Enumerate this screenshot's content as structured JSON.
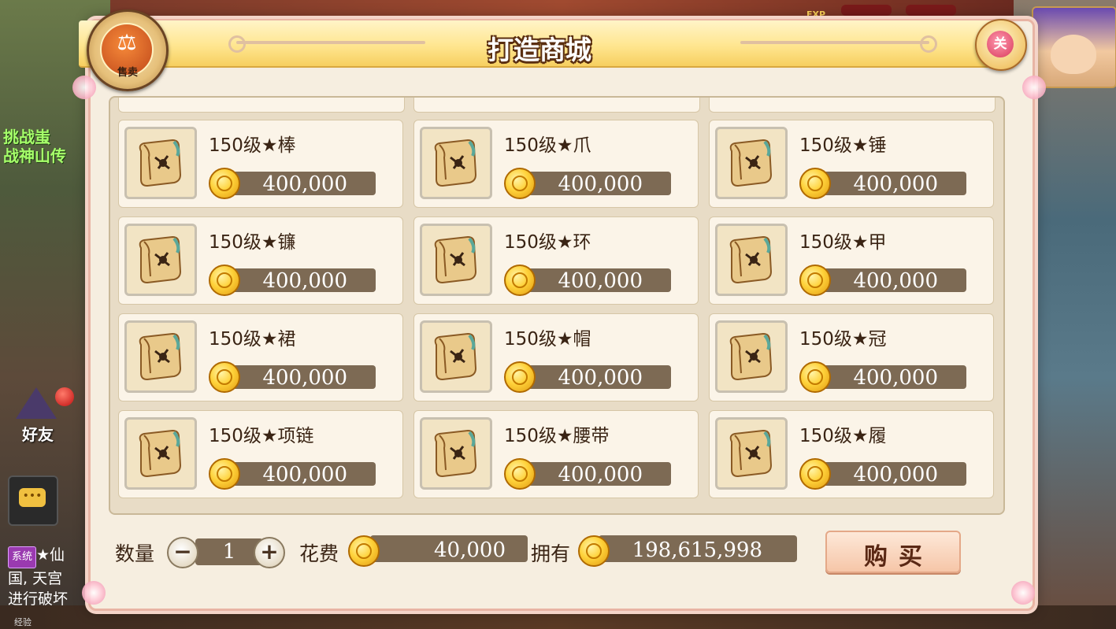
{
  "title": "打造商城",
  "sell_button": {
    "label": "售卖",
    "glyph": "⚖"
  },
  "close_button": {
    "label": "关"
  },
  "background": {
    "challenge_text": "挑战蚩\n战神山传",
    "friend_label": "好友",
    "system_tag": "系统",
    "system_message": "★仙\n国, 天宫\n进行破坏",
    "exp_label": "经验",
    "exp_tag": "EXP"
  },
  "items": [
    {
      "name": "150级★棒",
      "price": "400,000",
      "icon": "weapon-scroll-icon"
    },
    {
      "name": "150级★爪",
      "price": "400,000",
      "icon": "weapon-scroll-icon"
    },
    {
      "name": "150级★锤",
      "price": "400,000",
      "icon": "weapon-scroll-icon"
    },
    {
      "name": "150级★镰",
      "price": "400,000",
      "icon": "weapon-scroll-icon"
    },
    {
      "name": "150级★环",
      "price": "400,000",
      "icon": "weapon-scroll-icon"
    },
    {
      "name": "150级★甲",
      "price": "400,000",
      "icon": "armor-scroll-icon"
    },
    {
      "name": "150级★裙",
      "price": "400,000",
      "icon": "armor-scroll-icon"
    },
    {
      "name": "150级★帽",
      "price": "400,000",
      "icon": "armor-scroll-icon"
    },
    {
      "name": "150级★冠",
      "price": "400,000",
      "icon": "armor-scroll-icon"
    },
    {
      "name": "150级★项链",
      "price": "400,000",
      "icon": "accessory-scroll-icon"
    },
    {
      "name": "150级★腰带",
      "price": "400,000",
      "icon": "accessory-scroll-icon"
    },
    {
      "name": "150级★履",
      "price": "400,000",
      "icon": "accessory-scroll-icon"
    }
  ],
  "purchase": {
    "quantity_label": "数量",
    "quantity": "1",
    "minus_label": "−",
    "plus_label": "+",
    "cost_label": "花费",
    "cost": "40,000",
    "owned_label": "拥有",
    "owned": "198,615,998",
    "buy_label": "购买"
  },
  "colors": {
    "panel_bg": "#f6eee0",
    "value_bar": "#7d6a54",
    "title_gold": "#ffe690",
    "coin_gold": "#ffd23a"
  }
}
